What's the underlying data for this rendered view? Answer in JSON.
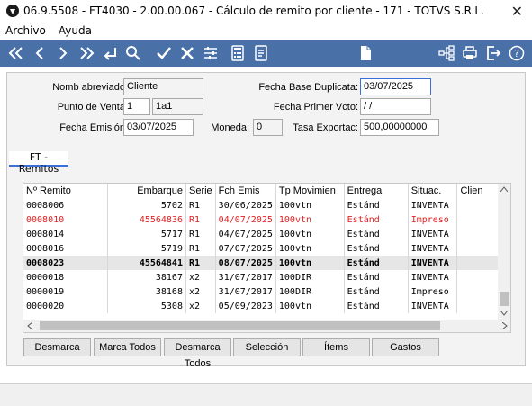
{
  "window": {
    "title": "06.9.5508 - FT4030 - 2.00.00.067 - Cálculo de remito por cliente - 171 - TOTVS S.R.L.",
    "close_glyph": "✕"
  },
  "menu": {
    "items": [
      "Archivo",
      "Ayuda"
    ]
  },
  "toolbar": {
    "icons": [
      "first-icon",
      "prev-icon",
      "next-icon",
      "last-icon",
      "return-icon",
      "search-icon",
      "confirm-icon",
      "cancel-icon",
      "filter-icon",
      "calculator-icon",
      "report-icon",
      "new-document-icon",
      "tree-icon",
      "print-icon",
      "exit-icon",
      "help-icon"
    ]
  },
  "form": {
    "nomb_abreviado": {
      "label": "Nomb abreviado:",
      "value": "Cliente"
    },
    "punto_venta": {
      "label": "Punto de Venta:",
      "value1": "1",
      "value2": "1a1"
    },
    "fecha_emision": {
      "label": "Fecha Emisión:",
      "value": "03/07/2025"
    },
    "moneda": {
      "label": "Moneda:",
      "value": "0"
    },
    "fecha_base_duplicata": {
      "label": "Fecha Base Duplicata:",
      "value": "03/07/2025"
    },
    "fecha_primer_vcto": {
      "label": "Fecha Primer Vcto:",
      "value": " / /"
    },
    "tasa_exportac": {
      "label": "Tasa Exportac:",
      "value": "500,00000000"
    }
  },
  "tab": {
    "label": "FT - Remitos"
  },
  "grid": {
    "columns": [
      "Nº Remito",
      "Embarque",
      "Serie",
      "Fch Emis",
      "Tp Movimien",
      "Entrega",
      "Situac.",
      "Clien"
    ],
    "rows": [
      {
        "style": "normal",
        "cells": [
          "0008006",
          "5702",
          "R1",
          "30/06/2025",
          "100vtn",
          "Estánd",
          "INVENTA",
          ""
        ]
      },
      {
        "style": "red",
        "cells": [
          "0008010",
          "45564836",
          "R1",
          "04/07/2025",
          "100vtn",
          "Estánd",
          "Impreso",
          ""
        ]
      },
      {
        "style": "normal",
        "cells": [
          "0008014",
          "5717",
          "R1",
          "04/07/2025",
          "100vtn",
          "Estánd",
          "INVENTA",
          ""
        ]
      },
      {
        "style": "normal",
        "cells": [
          "0008016",
          "5719",
          "R1",
          "07/07/2025",
          "100vtn",
          "Estánd",
          "INVENTA",
          ""
        ]
      },
      {
        "style": "bold",
        "cells": [
          "0008023",
          "45564841",
          "R1",
          "08/07/2025",
          "100vtn",
          "Estánd",
          "INVENTA",
          ""
        ]
      },
      {
        "style": "normal",
        "cells": [
          "0000018",
          "38167",
          "x2",
          "31/07/2017",
          "100DIR",
          "Estánd",
          "INVENTA",
          ""
        ]
      },
      {
        "style": "normal",
        "cells": [
          "0000019",
          "38168",
          "x2",
          "31/07/2017",
          "100DIR",
          "Estánd",
          "Impreso",
          ""
        ]
      },
      {
        "style": "normal",
        "cells": [
          "0000020",
          "5308",
          "x2",
          "05/09/2023",
          "100vtn",
          "Estánd",
          "INVENTA",
          ""
        ]
      }
    ]
  },
  "buttons": {
    "desmarca": "Desmarca",
    "marca_todos": "Marca Todos",
    "desmarca_todos": "Desmarca Todos",
    "seleccion": "Selección",
    "items": "Ítems",
    "gastos": "Gastos"
  },
  "colors": {
    "toolbar_bg": "#4a70a8",
    "highlight_red": "#e02020",
    "accent_blue": "#3a6fd6"
  }
}
